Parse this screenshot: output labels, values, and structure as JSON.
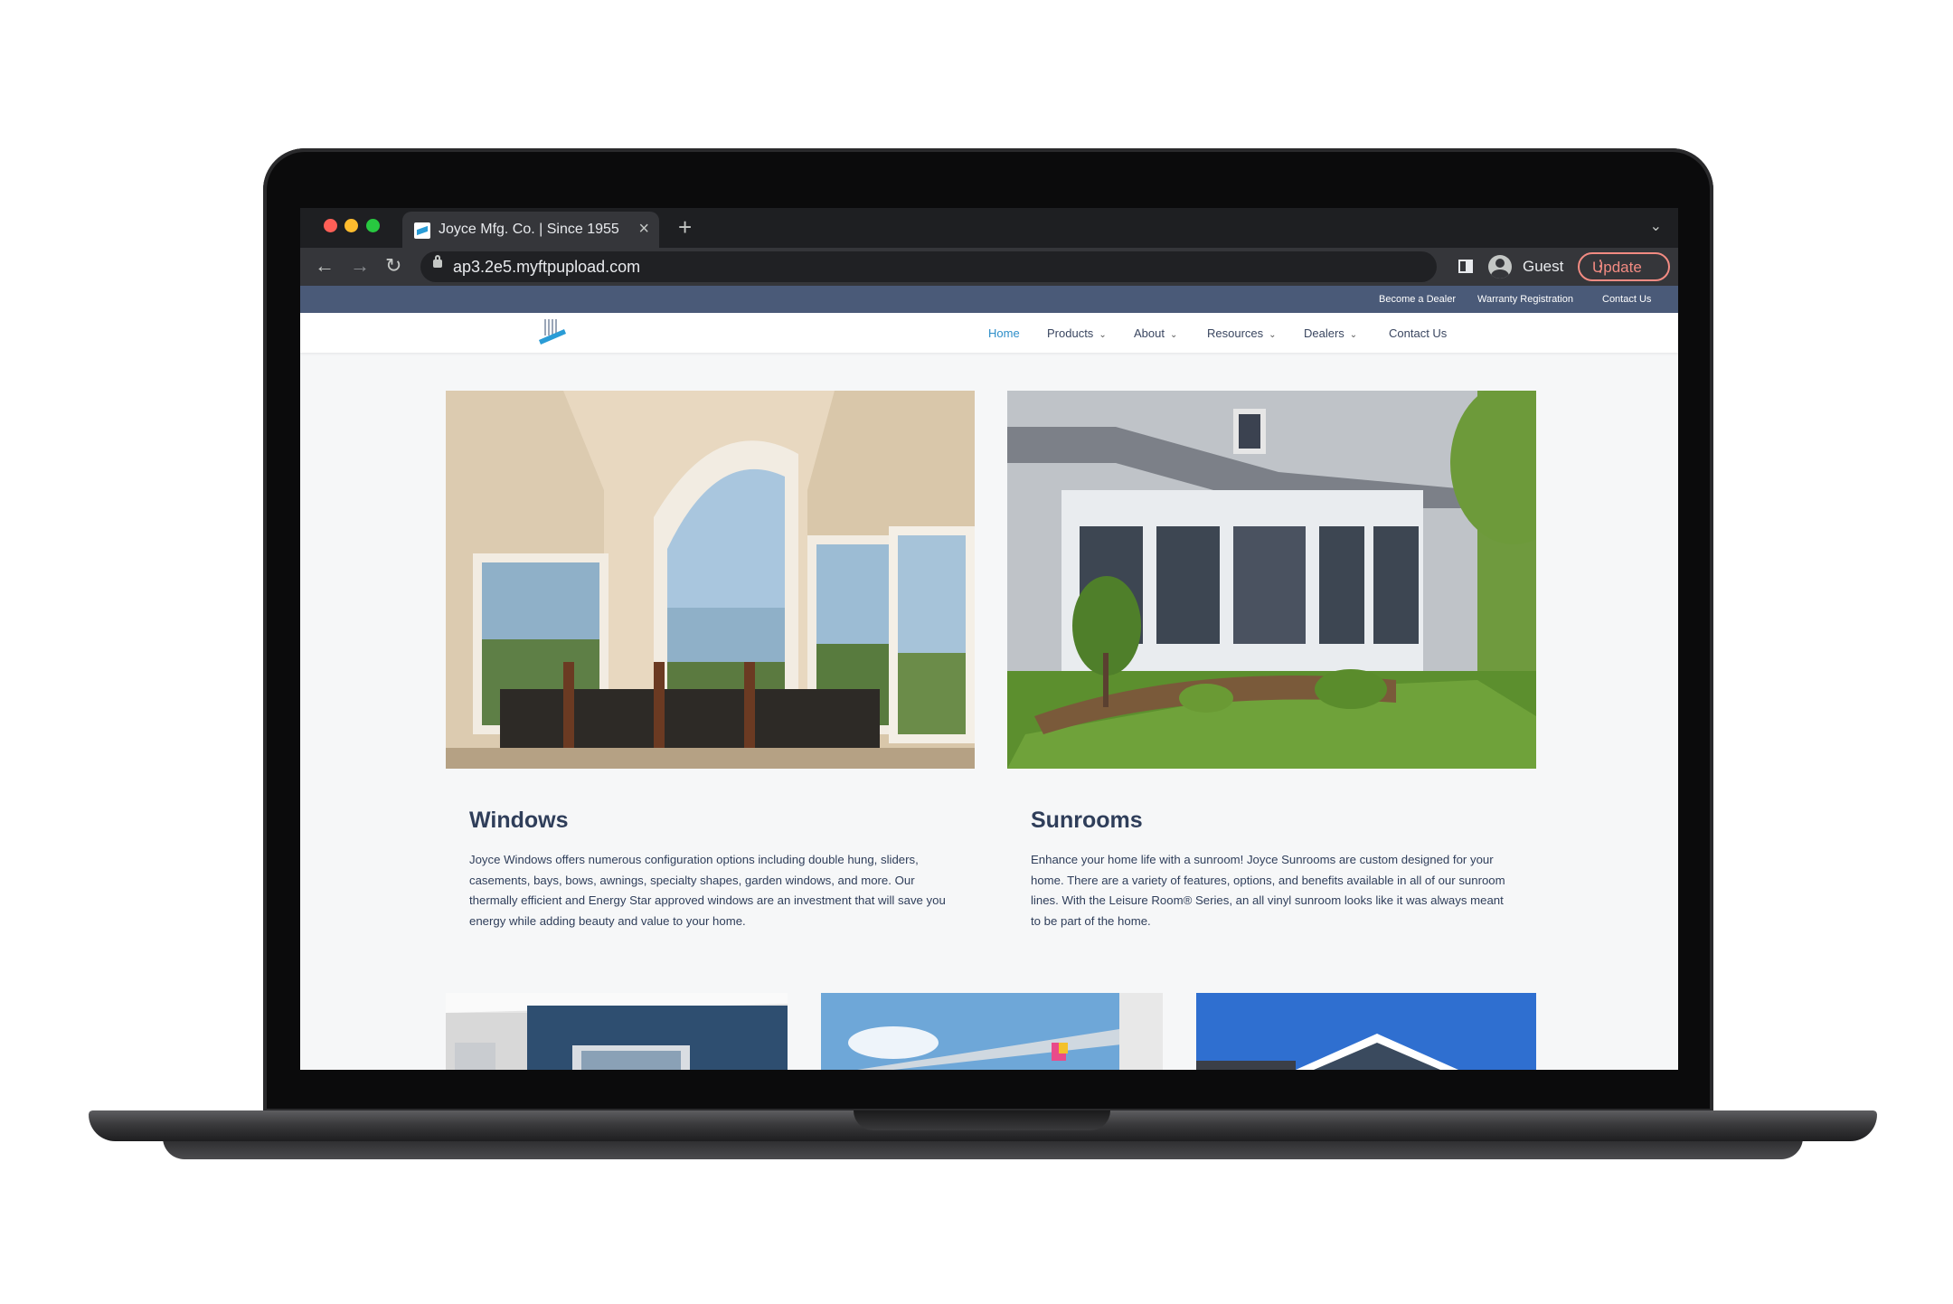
{
  "browser": {
    "tab_title": "Joyce Mfg. Co. | Since 1955",
    "tab_close": "×",
    "new_tab": "+",
    "tab_menu": "⌄",
    "url": "ap3.2e5.myftpupload.com",
    "profile_label": "Guest",
    "update_label": "Update",
    "update_menu": "⋮",
    "back": "←",
    "forward": "→",
    "reload": "↻"
  },
  "site": {
    "topbar_links": [
      "Become a Dealer",
      "Warranty Registration",
      "Contact Us"
    ],
    "menu": {
      "home": "Home",
      "products": "Products",
      "about": "About",
      "resources": "Resources",
      "dealers": "Dealers",
      "contact": "Contact Us",
      "chevron": "⌄"
    },
    "colors": {
      "topbar": "#4a5a78",
      "active_link": "#2d8ec9",
      "text": "#2f3e5a"
    }
  },
  "products": [
    {
      "title": "Windows",
      "description": "Joyce Windows offers numerous configuration options including double hung, sliders, casements, bays, bows, awnings, specialty shapes, garden windows, and more. Our thermally efficient and Energy Star approved windows are an investment that will save you energy while adding beauty and value to your home."
    },
    {
      "title": "Sunrooms",
      "description": "Enhance your home life with a sunroom! Joyce Sunrooms are custom designed for your home. There are a variety of features, options, and benefits available in all of our sunroom lines. With the Leisure Room® Series, an all vinyl sunroom looks like it was always meant to be part of the home."
    }
  ]
}
